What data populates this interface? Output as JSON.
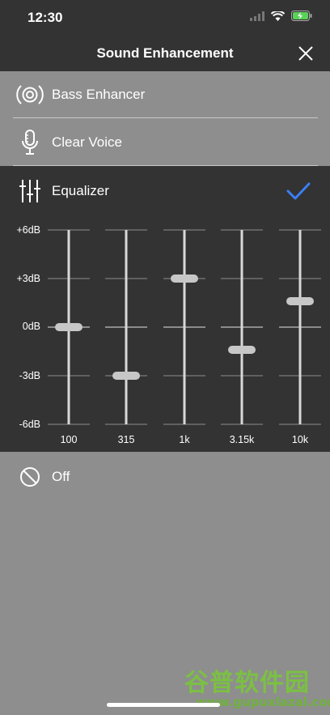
{
  "status_bar": {
    "time": "12:30"
  },
  "nav": {
    "title": "Sound Enhancement",
    "close_icon": "close-icon"
  },
  "options": [
    {
      "label": "Bass Enhancer",
      "icon": "speaker-icon",
      "selected": false
    },
    {
      "label": "Clear Voice",
      "icon": "microphone-icon",
      "selected": false
    },
    {
      "label": "Equalizer",
      "icon": "sliders-icon",
      "selected": true
    },
    {
      "label": "Off",
      "icon": "off-icon",
      "selected": false
    }
  ],
  "equalizer": {
    "db_labels": [
      "+6dB",
      "+3dB",
      "0dB",
      "-3dB",
      "-6dB"
    ],
    "bands": [
      {
        "freq": "100",
        "level_db": 0
      },
      {
        "freq": "315",
        "level_db": -3
      },
      {
        "freq": "1k",
        "level_db": 3
      },
      {
        "freq": "3.15k",
        "level_db": -1.4
      },
      {
        "freq": "10k",
        "level_db": 1.6
      }
    ]
  },
  "colors": {
    "accent": "#3b7ff5",
    "panel_bg": "#333333",
    "page_bg": "#8e8e8e",
    "watermark": "#7bc043"
  },
  "watermark": {
    "text": "谷普软件园",
    "url_text": "www.gupuxlazal.com"
  }
}
